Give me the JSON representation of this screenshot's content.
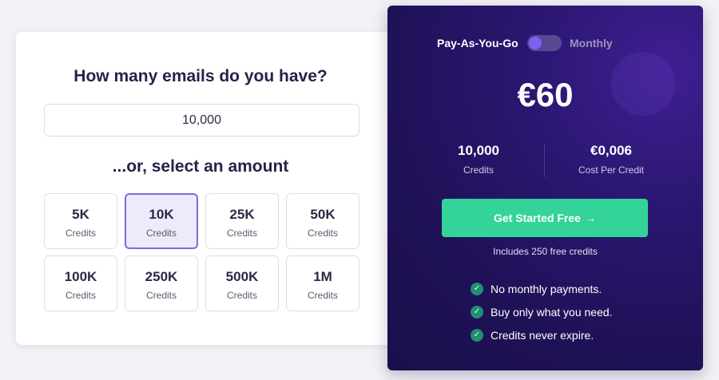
{
  "calculator": {
    "title": "How many emails do you have?",
    "email_count_value": "10,000",
    "select_title": "...or, select an amount",
    "options": [
      {
        "amount": "5K",
        "unit": "Credits",
        "selected": false
      },
      {
        "amount": "10K",
        "unit": "Credits",
        "selected": true
      },
      {
        "amount": "25K",
        "unit": "Credits",
        "selected": false
      },
      {
        "amount": "50K",
        "unit": "Credits",
        "selected": false
      },
      {
        "amount": "100K",
        "unit": "Credits",
        "selected": false
      },
      {
        "amount": "250K",
        "unit": "Credits",
        "selected": false
      },
      {
        "amount": "500K",
        "unit": "Credits",
        "selected": false
      },
      {
        "amount": "1M",
        "unit": "Credits",
        "selected": false
      }
    ]
  },
  "pricing": {
    "toggle": {
      "left_label": "Pay-As-You-Go",
      "right_label": "Monthly",
      "active": "Pay-As-You-Go"
    },
    "price": "€60",
    "credits_value": "10,000",
    "credits_label": "Credits",
    "cost_value": "€0,006",
    "cost_label": "Cost Per Credit",
    "cta_label": "Get Started Free",
    "cta_arrow": "→",
    "note": "Includes 250 free credits",
    "check_glyph": "✓",
    "features": [
      "No monthly payments.",
      "Buy only what you need.",
      "Credits never expire."
    ]
  },
  "colors": {
    "page_background": "#f1f1f6",
    "panel_background": "#1f1156",
    "accent_purple": "#7b62f2",
    "cta_green": "#34d39a",
    "heading_text": "#25234a"
  }
}
